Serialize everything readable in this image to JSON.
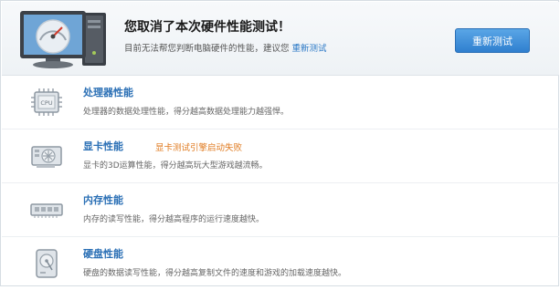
{
  "header": {
    "title": "您取消了本次硬件性能测试！",
    "subtitle_text": "目前无法帮您判断电脑硬件的性能，建议您",
    "subtitle_link": "重新测试",
    "retest_button": "重新测试"
  },
  "items": [
    {
      "icon": "cpu-icon",
      "name": "处理器性能",
      "desc": "处理器的数据处理性能，得分越高数据处理能力越强悍。",
      "warning": ""
    },
    {
      "icon": "graphics-card-icon",
      "name": "显卡性能",
      "desc": "显卡的3D运算性能，得分越高玩大型游戏越流畅。",
      "warning": "显卡测试引擎启动失败"
    },
    {
      "icon": "memory-icon",
      "name": "内存性能",
      "desc": "内存的读写性能，得分越高程序的运行速度越快。",
      "warning": ""
    },
    {
      "icon": "hard-disk-icon",
      "name": "硬盘性能",
      "desc": "硬盘的数据读写性能，得分越高复制文件的速度和游戏的加载速度越快。",
      "warning": ""
    }
  ],
  "colors": {
    "accent": "#2a6fb5",
    "warning": "#e07b21",
    "button": "#3a8ad8"
  }
}
